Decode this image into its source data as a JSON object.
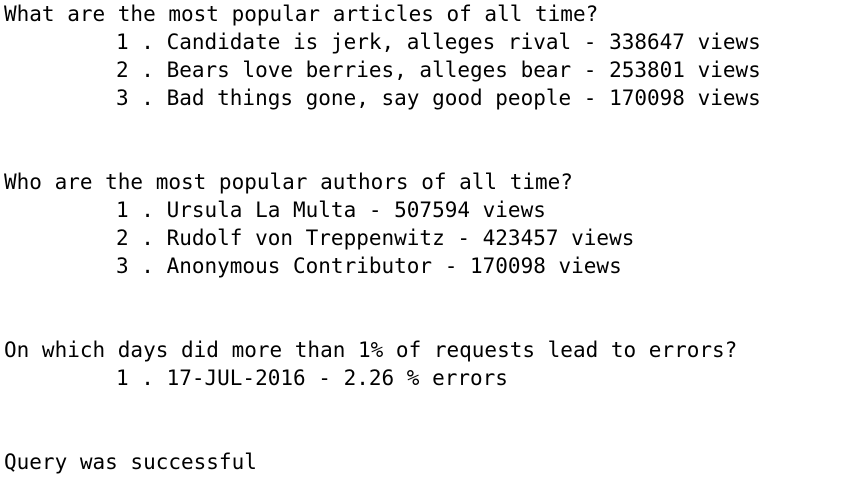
{
  "sections": [
    {
      "question": "What are the most popular articles of all time?",
      "items": [
        "1 . Candidate is jerk, alleges rival - 338647 views",
        "2 . Bears love berries, alleges bear - 253801 views",
        "3 . Bad things gone, say good people - 170098 views"
      ]
    },
    {
      "question": "Who are the most popular authors of all time?",
      "items": [
        "1 . Ursula La Multa - 507594 views",
        "2 . Rudolf von Treppenwitz - 423457 views",
        "3 . Anonymous Contributor - 170098 views"
      ]
    },
    {
      "question": "On which days did more than 1% of requests lead to errors?",
      "items": [
        "1 . 17-JUL-2016 - 2.26 % errors"
      ]
    }
  ],
  "status": "Query was successful"
}
